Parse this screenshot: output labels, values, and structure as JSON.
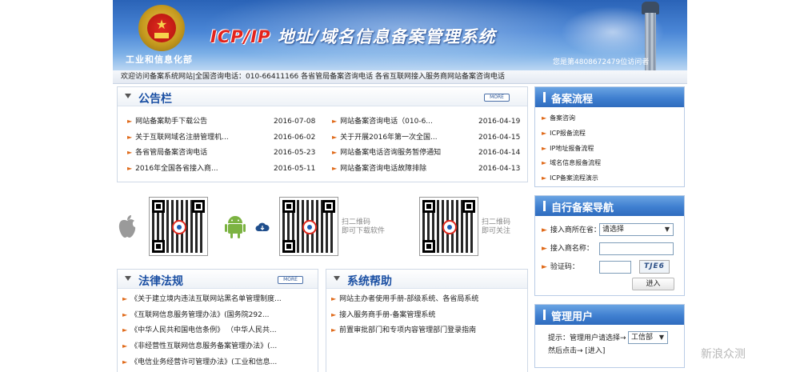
{
  "header": {
    "ministry": "工业和信息化部",
    "title_prefix": "ICP/IP",
    "title_rest": " 地址/域名信息备案管理系统",
    "visitor": "您是第4808672479位访问者"
  },
  "notice_bar": "欢迎访问备案系统网站|全国咨询电话：010-66411166 各省管局备案咨询电话 各省互联网接入服务商网站备案咨询电话",
  "more_label": "MORE",
  "bulletin": {
    "title": "公告栏",
    "left": [
      {
        "text": "网站备案助手下载公告",
        "date": "2016-07-08"
      },
      {
        "text": "关于互联网域名注册管理机...",
        "date": "2016-06-02"
      },
      {
        "text": "各省管局备案咨询电话",
        "date": "2016-05-23"
      },
      {
        "text": "2016年全国各省接入商...",
        "date": "2016-05-11"
      }
    ],
    "right": [
      {
        "text": "网站备案咨询电话（010-6...",
        "date": "2016-04-19"
      },
      {
        "text": "关于开展2016年第一次全国...",
        "date": "2016-04-15"
      },
      {
        "text": "网站备案电话咨询服务暂停通知",
        "date": "2016-04-14"
      },
      {
        "text": "网站备案咨询电话故障排除",
        "date": "2016-04-13"
      }
    ]
  },
  "qr": {
    "download_line1": "扫二维码",
    "download_line2": "即可下载软件",
    "follow_line1": "扫二维码",
    "follow_line2": "即可关注"
  },
  "laws": {
    "title": "法律法规",
    "items": [
      "《关于建立境内违法互联网站黑名单管理制度...",
      "《互联网信息服务管理办法》(国务院292...",
      "《中华人民共和国电信条例》 （中华人民共...",
      "《非经营性互联网信息服务备案管理办法》(...",
      "《电信业务经营许可管理办法》(工业和信息..."
    ]
  },
  "help": {
    "title": "系统帮助",
    "items": [
      "网站主办者使用手册-部级系统、各省局系统",
      "接入服务商手册-备案管理系统",
      "前置审批部门和专项内容管理部门登录指南"
    ]
  },
  "flow": {
    "title": "备案流程",
    "items": [
      "备案咨询",
      "ICP报备流程",
      "IP地址报备流程",
      "域名信息报备流程",
      "ICP备案流程演示"
    ]
  },
  "nav": {
    "title": "自行备案导航",
    "province_label": "接入商所在省：",
    "province_value": "请选择",
    "name_label": "接入商名称：",
    "captcha_label": "验证码：",
    "captcha_text": "TJE6",
    "enter_label": "进入"
  },
  "admin": {
    "title": "管理用户",
    "hint1": "提示：管理用户请选择→",
    "select_value": "工信部",
    "hint2": "然后点击→ [进入]"
  },
  "watermark": "新浪众测",
  "colors": {
    "header_blue": "#2a63b7",
    "title_blue": "#1a4fa3",
    "bullet_orange": "#e06a1a",
    "right_title_blue": "#3f7fd0"
  }
}
